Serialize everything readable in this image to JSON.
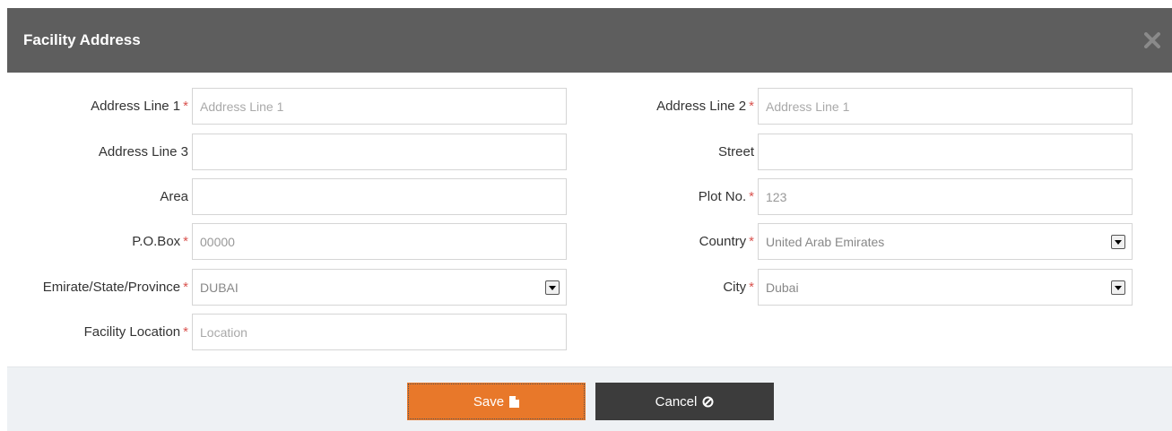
{
  "modal": {
    "title": "Facility Address",
    "close_icon": "close-x-icon"
  },
  "fields": {
    "address_line_1": {
      "label": "Address Line 1",
      "required": "*",
      "placeholder": "Address Line 1",
      "value": ""
    },
    "address_line_2": {
      "label": "Address Line 2",
      "required": "*",
      "placeholder": "Address Line 1",
      "value": ""
    },
    "address_line_3": {
      "label": "Address Line 3",
      "value": ""
    },
    "street": {
      "label": "Street",
      "value": ""
    },
    "area": {
      "label": "Area",
      "value": ""
    },
    "plot_no": {
      "label": "Plot No.",
      "required": "*",
      "value": "123"
    },
    "po_box": {
      "label": "P.O.Box",
      "required": "*",
      "value": "00000"
    },
    "country": {
      "label": "Country",
      "required": "*",
      "selected": "United Arab Emirates"
    },
    "emirate": {
      "label": "Emirate/State/Province",
      "required": "*",
      "selected": "DUBAI"
    },
    "city": {
      "label": "City",
      "required": "*",
      "selected": "Dubai"
    },
    "facility_location": {
      "label": "Facility Location",
      "required": "*",
      "placeholder": "Location",
      "value": ""
    }
  },
  "footer": {
    "save_label": "Save",
    "save_icon": "document-icon",
    "cancel_label": "Cancel",
    "cancel_icon": "circle-slash-icon"
  },
  "colors": {
    "header_bg": "#5e5e5e",
    "save_bg": "#e8782a",
    "cancel_bg": "#3c3c3c",
    "required": "#d9534f",
    "footer_bg": "#eef1f4"
  }
}
